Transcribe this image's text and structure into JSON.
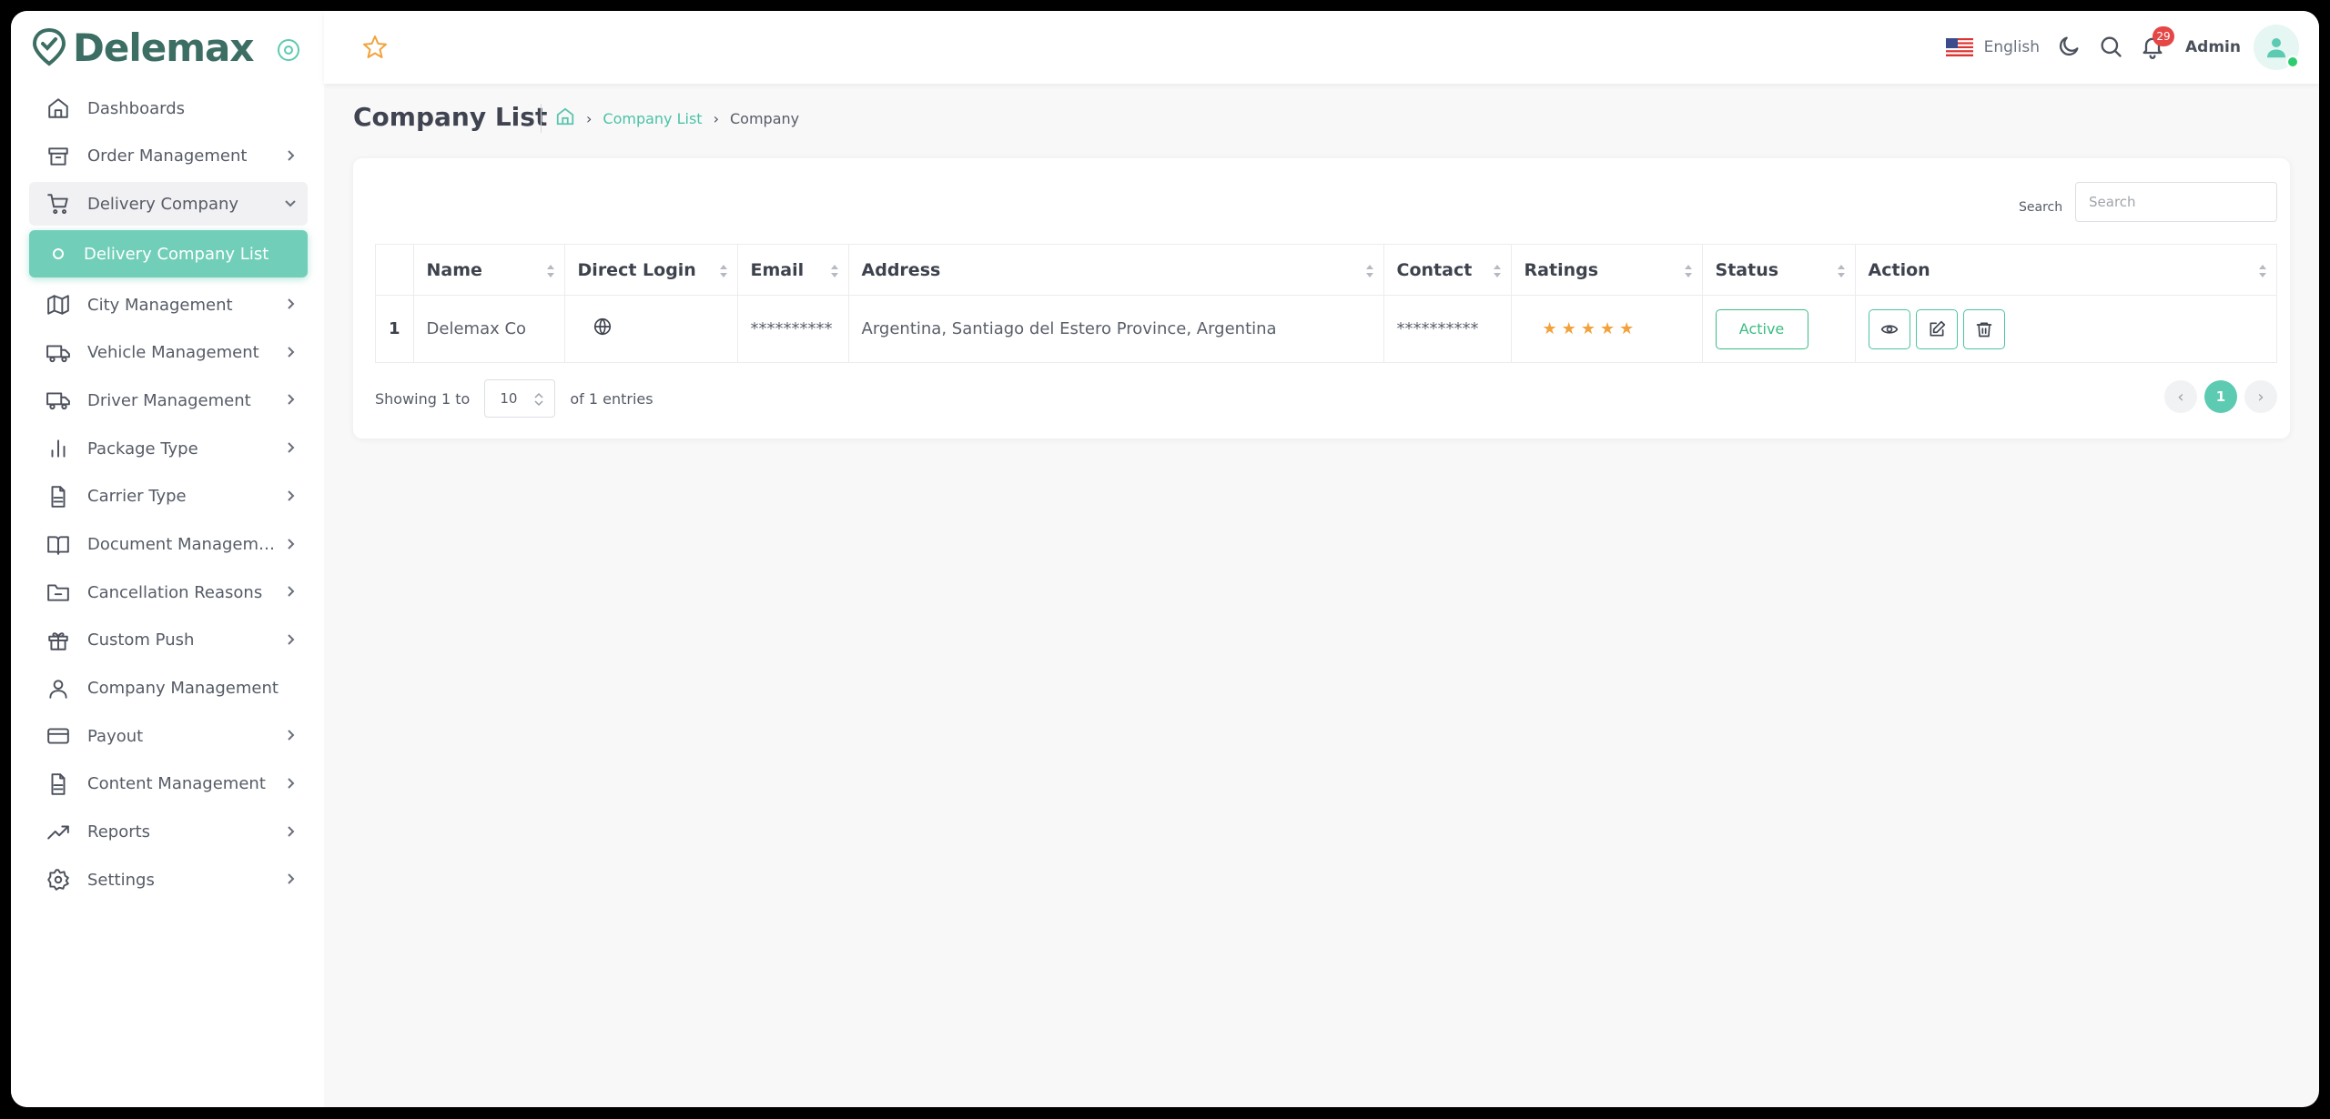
{
  "brand": {
    "name": "Delemax",
    "color": "#3c6e63",
    "accent": "#5ccbb1"
  },
  "sidebar": {
    "items": [
      {
        "label": "Dashboards",
        "icon": "home-icon",
        "has_arrow": false
      },
      {
        "label": "Order Management",
        "icon": "archive-icon",
        "has_arrow": true
      },
      {
        "label": "Delivery Company",
        "icon": "cart-icon",
        "has_arrow": true,
        "open": true
      },
      {
        "label": "City Management",
        "icon": "map-icon",
        "has_arrow": true
      },
      {
        "label": "Vehicle Management",
        "icon": "truck-icon",
        "has_arrow": true
      },
      {
        "label": "Driver Management",
        "icon": "truck-icon",
        "has_arrow": true
      },
      {
        "label": "Package Type",
        "icon": "bar-chart-icon",
        "has_arrow": true
      },
      {
        "label": "Carrier Type",
        "icon": "file-icon",
        "has_arrow": true
      },
      {
        "label": "Document Management",
        "icon": "book-icon",
        "has_arrow": true
      },
      {
        "label": "Cancellation Reasons",
        "icon": "folder-minus-icon",
        "has_arrow": true
      },
      {
        "label": "Custom Push",
        "icon": "gift-icon",
        "has_arrow": true
      },
      {
        "label": "Company Management",
        "icon": "user-icon",
        "has_arrow": false
      },
      {
        "label": "Payout",
        "icon": "credit-card-icon",
        "has_arrow": true
      },
      {
        "label": "Content Management",
        "icon": "file-icon",
        "has_arrow": true
      },
      {
        "label": "Reports",
        "icon": "trending-up-icon",
        "has_arrow": true
      },
      {
        "label": "Settings",
        "icon": "gear-icon",
        "has_arrow": true
      }
    ],
    "active_sub": {
      "label": "Delivery Company List"
    }
  },
  "header": {
    "language": "English",
    "notification_count": "29",
    "user_name": "Admin"
  },
  "page": {
    "title": "Company List",
    "breadcrumb": {
      "link": "Company List",
      "current": "Company"
    }
  },
  "table": {
    "search_label": "Search",
    "search_placeholder": "Search",
    "columns": [
      "",
      "Name",
      "Direct Login",
      "Email",
      "Address",
      "Contact",
      "Ratings",
      "Status",
      "Action"
    ],
    "rows": [
      {
        "index": "1",
        "name": "Delemax Co",
        "email": "**********",
        "address": "Argentina, Santiago del Estero Province, Argentina",
        "contact": "**********",
        "rating": 5,
        "status": "Active"
      }
    ],
    "footer": {
      "showing_prefix": "Showing 1 to",
      "page_size": "10",
      "showing_suffix": "of 1 entries",
      "current_page": "1"
    }
  }
}
